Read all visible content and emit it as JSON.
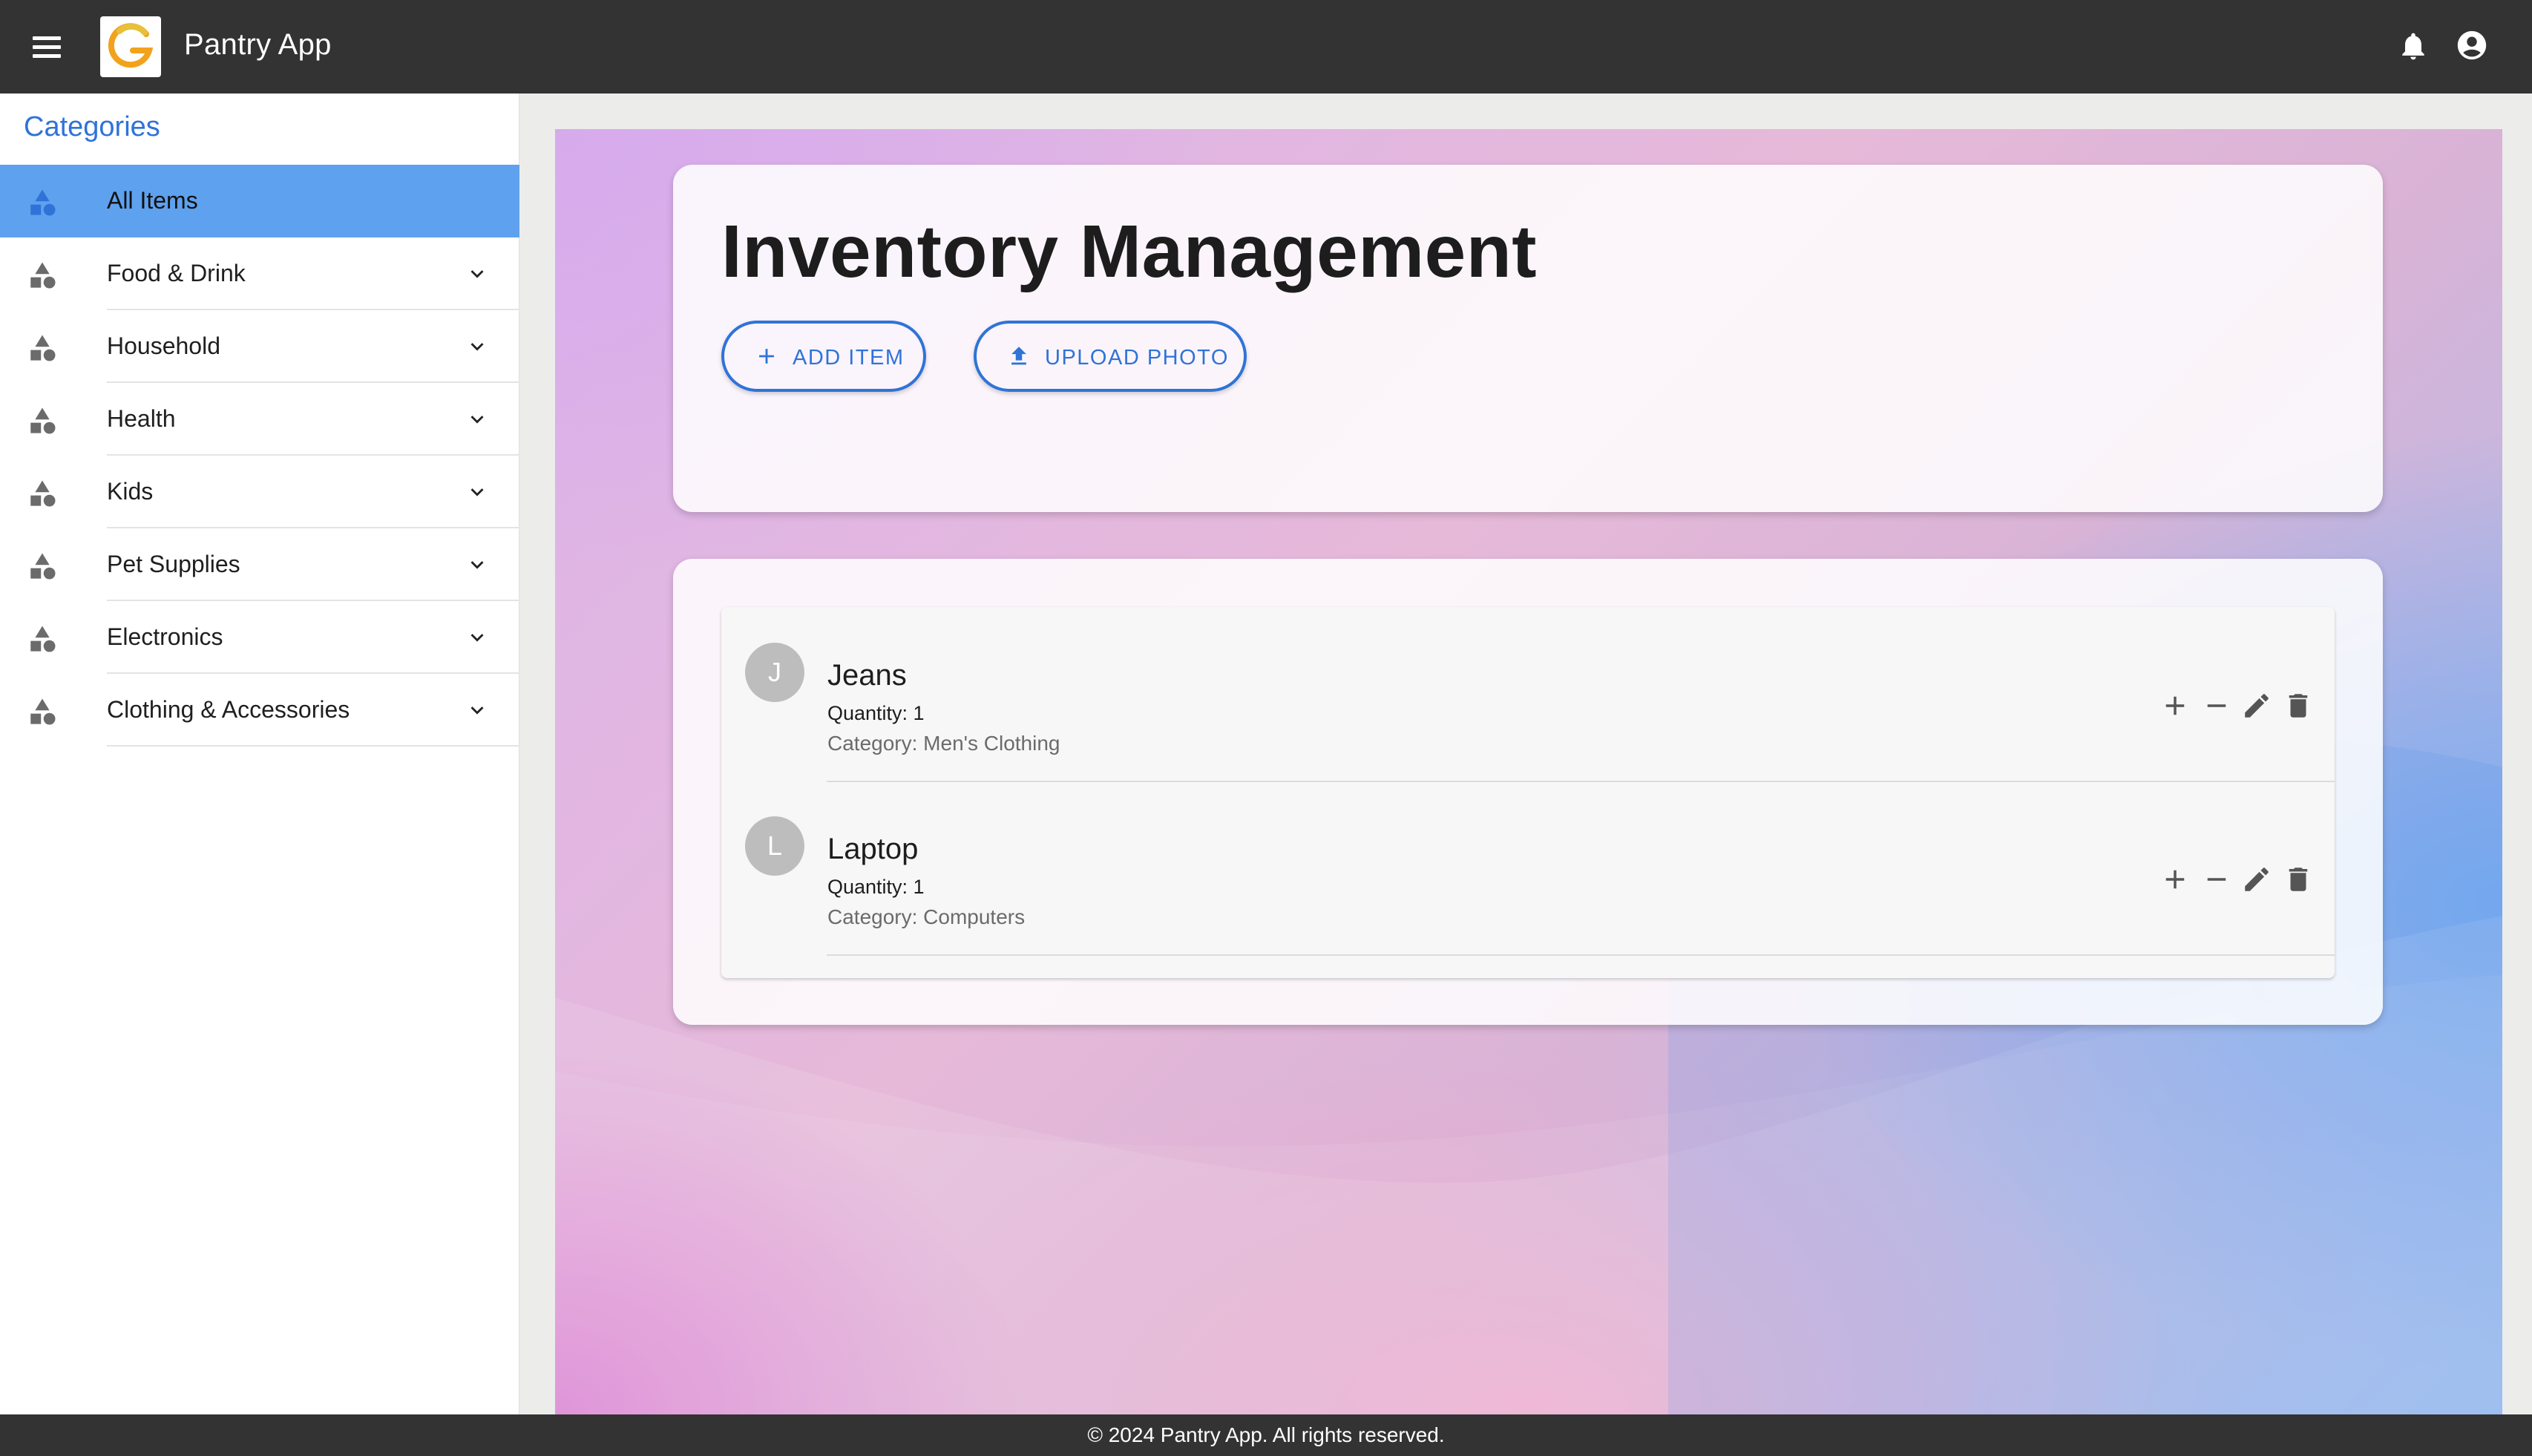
{
  "app": {
    "title": "Pantry App",
    "icons": {
      "menu": "menu-icon",
      "logo": "app-logo",
      "notifications": "bell-icon",
      "account": "account-circle-icon"
    }
  },
  "sidebar": {
    "heading": "Categories",
    "items": [
      {
        "label": "All Items",
        "active": true,
        "expandable": false
      },
      {
        "label": "Food & Drink",
        "active": false,
        "expandable": true
      },
      {
        "label": "Household",
        "active": false,
        "expandable": true
      },
      {
        "label": "Health",
        "active": false,
        "expandable": true
      },
      {
        "label": "Kids",
        "active": false,
        "expandable": true
      },
      {
        "label": "Pet Supplies",
        "active": false,
        "expandable": true
      },
      {
        "label": "Electronics",
        "active": false,
        "expandable": true
      },
      {
        "label": "Clothing & Accessories",
        "active": false,
        "expandable": true
      }
    ]
  },
  "main": {
    "title": "Inventory Management",
    "add_item_label": "ADD ITEM",
    "upload_photo_label": "UPLOAD PHOTO",
    "items": [
      {
        "avatar": "J",
        "name": "Jeans",
        "quantity": "Quantity: 1",
        "category": "Category: Men's Clothing"
      },
      {
        "avatar": "L",
        "name": "Laptop",
        "quantity": "Quantity: 1",
        "category": "Category: Computers"
      }
    ]
  },
  "footer": {
    "text": "© 2024 Pantry App. All rights reserved."
  },
  "colors": {
    "accent": "#2f73d8",
    "active_item": "#5ea1ee",
    "appbar": "#333333"
  }
}
